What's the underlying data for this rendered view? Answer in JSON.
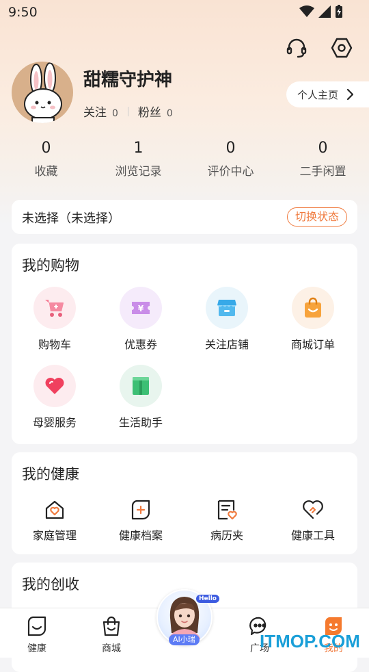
{
  "status_bar": {
    "time": "9:50"
  },
  "profile": {
    "username": "甜糯守护神",
    "follow_label": "关注",
    "follow_count": "0",
    "fans_label": "粉丝",
    "fans_count": "0",
    "homepage_label": "个人主页"
  },
  "stats": [
    {
      "value": "0",
      "label": "收藏"
    },
    {
      "value": "1",
      "label": "浏览记录"
    },
    {
      "value": "0",
      "label": "评价中心"
    },
    {
      "value": "0",
      "label": "二手闲置"
    }
  ],
  "state_card": {
    "text": "未选择（未选择）",
    "switch_label": "切换状态"
  },
  "shopping": {
    "title": "我的购物",
    "items": [
      {
        "label": "购物车",
        "icon": "shopping-cart-icon",
        "bg": "#fdecef"
      },
      {
        "label": "优惠券",
        "icon": "coupon-icon",
        "bg": "#f5ebfb"
      },
      {
        "label": "关注店铺",
        "icon": "store-icon",
        "bg": "#e9f5fb"
      },
      {
        "label": "商城订单",
        "icon": "shopping-bag-icon",
        "bg": "#fdf1e6"
      },
      {
        "label": "母婴服务",
        "icon": "heart-icon",
        "bg": "#fdecef"
      },
      {
        "label": "生活助手",
        "icon": "book-icon",
        "bg": "#e8f5ee"
      }
    ]
  },
  "health": {
    "title": "我的健康",
    "items": [
      {
        "label": "家庭管理",
        "icon": "home-heart-icon"
      },
      {
        "label": "健康档案",
        "icon": "health-record-icon"
      },
      {
        "label": "病历夹",
        "icon": "medical-folder-icon"
      },
      {
        "label": "健康工具",
        "icon": "health-tool-icon"
      }
    ]
  },
  "earn": {
    "title": "我的创收"
  },
  "ai_assistant": {
    "badge": "AI小瑞",
    "greeting": "Hello"
  },
  "bottom_nav": [
    {
      "label": "健康",
      "icon": "health-tab-icon"
    },
    {
      "label": "商城",
      "icon": "mall-bag-icon"
    },
    {
      "label": "广场",
      "icon": "chat-bubble-icon"
    },
    {
      "label": "我的",
      "icon": "mine-face-icon"
    }
  ],
  "watermark": "ITMOP.COM",
  "colors": {
    "accent": "#f07b3f",
    "background": "#f4f4f6"
  }
}
